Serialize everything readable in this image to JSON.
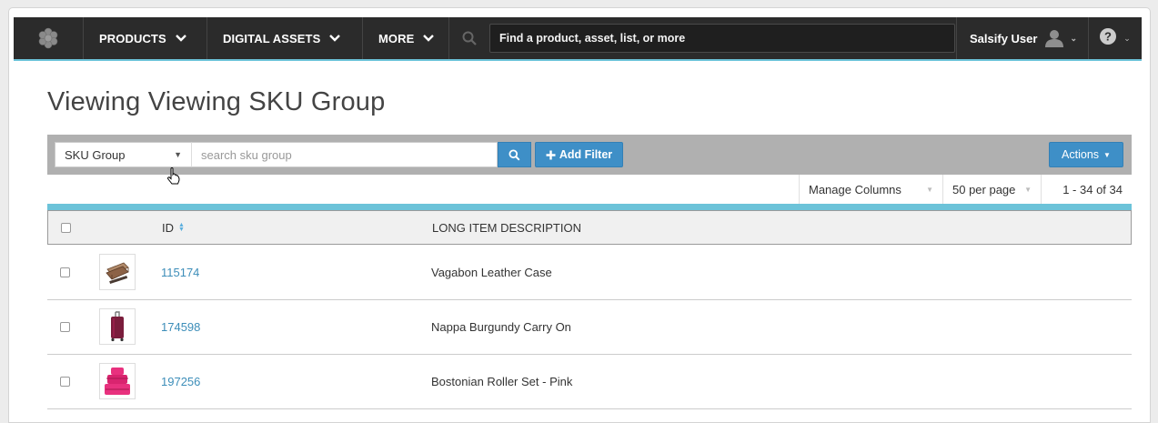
{
  "nav": {
    "logo": "salsify-logo",
    "menus": [
      {
        "label": "PRODUCTS"
      },
      {
        "label": "DIGITAL ASSETS"
      },
      {
        "label": "MORE"
      }
    ],
    "search_placeholder": "Find a product, asset, list, or more",
    "user_name": "Salsify User"
  },
  "page": {
    "title": "Viewing Viewing SKU Group"
  },
  "filter": {
    "field_selected": "SKU Group",
    "search_placeholder": "search sku group",
    "add_filter_label": "Add Filter",
    "actions_label": "Actions"
  },
  "pager": {
    "manage_columns": "Manage Columns",
    "per_page": "50 per page",
    "count": "1 - 34 of 34"
  },
  "table": {
    "headers": {
      "id": "ID",
      "description": "LONG ITEM DESCRIPTION"
    },
    "rows": [
      {
        "id": "115174",
        "description": "Vagabon Leather Case",
        "thumb": "leather-case-image"
      },
      {
        "id": "174598",
        "description": "Nappa Burgundy Carry On",
        "thumb": "burgundy-suitcase-image"
      },
      {
        "id": "197256",
        "description": "Bostonian Roller Set - Pink",
        "thumb": "pink-luggage-set-image"
      }
    ]
  },
  "colors": {
    "accent": "#6cc3d9",
    "primary_button": "#3e8fc7",
    "link": "#3d8eb9",
    "nav_bg": "#2b2b2b"
  }
}
